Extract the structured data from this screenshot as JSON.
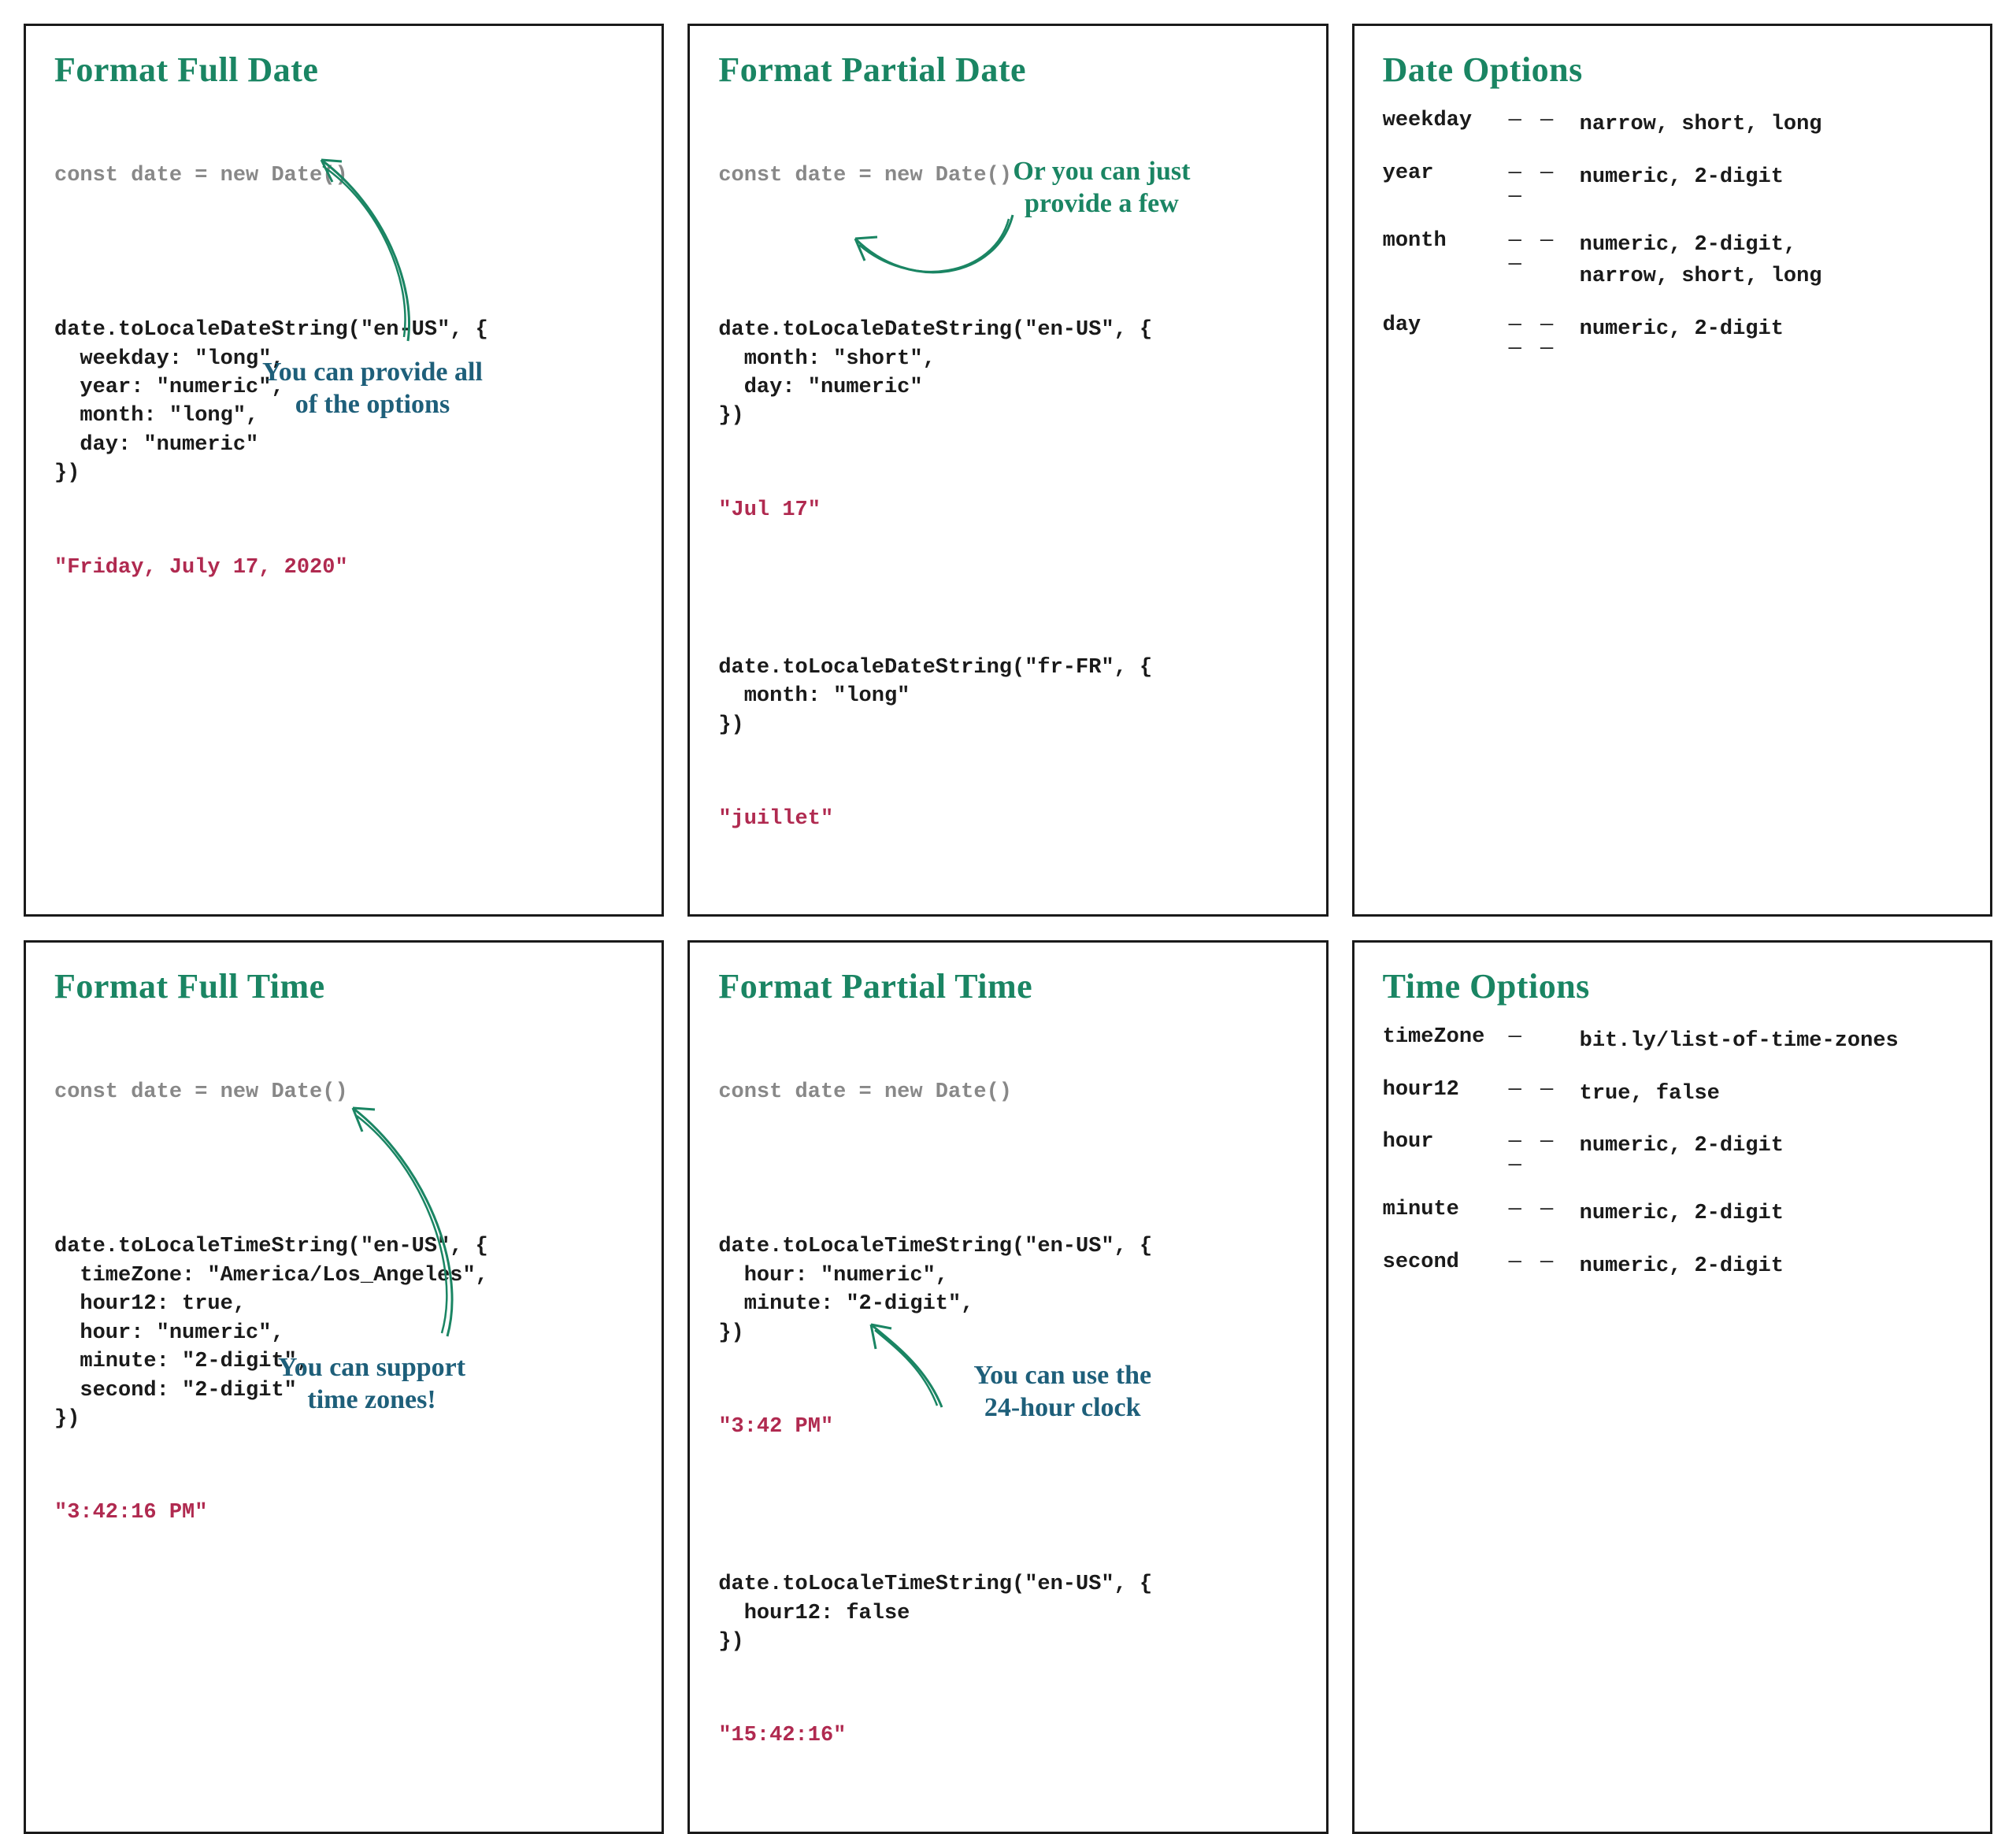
{
  "cards": {
    "full_date": {
      "title": "Format Full Date",
      "decl": "const date = new Date()",
      "code1": "date.toLocaleDateString(\"en-US\", {\n  weekday: \"long\",\n  year: \"numeric\",\n  month: \"long\",\n  day: \"numeric\"\n})",
      "output1": "\"Friday, July 17, 2020\"",
      "annot": "You can provide all\nof the options"
    },
    "partial_date": {
      "title": "Format Partial Date",
      "decl": "const date = new Date()",
      "code1": "date.toLocaleDateString(\"en-US\", {\n  month: \"short\",\n  day: \"numeric\"\n})",
      "output1": "\"Jul 17\"",
      "code2": "date.toLocaleDateString(\"fr-FR\", {\n  month: \"long\"\n})",
      "output2": "\"juillet\"",
      "annot": "Or you can just\nprovide a few"
    },
    "date_options": {
      "title": "Date Options",
      "rows": [
        {
          "key": "weekday",
          "dash": "— —",
          "val": "narrow, short, long"
        },
        {
          "key": "year",
          "dash": "— — —",
          "val": "numeric, 2-digit"
        },
        {
          "key": "month",
          "dash": "— — —",
          "val": "numeric, 2-digit,\nnarrow, short, long"
        },
        {
          "key": "day",
          "dash": "— — — —",
          "val": "numeric, 2-digit"
        }
      ]
    },
    "full_time": {
      "title": "Format Full Time",
      "decl": "const date = new Date()",
      "code1": "date.toLocaleTimeString(\"en-US\", {\n  timeZone: \"America/Los_Angeles\",\n  hour12: true,\n  hour: \"numeric\",\n  minute: \"2-digit\",\n  second: \"2-digit\"\n})",
      "output1": "\"3:42:16 PM\"",
      "annot": "You can support\ntime zones!"
    },
    "partial_time": {
      "title": "Format Partial Time",
      "decl": "const date = new Date()",
      "code1": "date.toLocaleTimeString(\"en-US\", {\n  hour: \"numeric\",\n  minute: \"2-digit\",\n})",
      "output1": "\"3:42 PM\"",
      "code2": "date.toLocaleTimeString(\"en-US\", {\n  hour12: false\n})",
      "output2": "\"15:42:16\"",
      "annot": "You can use the\n24-hour clock"
    },
    "time_options": {
      "title": "Time Options",
      "rows": [
        {
          "key": "timeZone",
          "dash": "—",
          "val": "bit.ly/list-of-time-zones"
        },
        {
          "key": "hour12",
          "dash": "— —",
          "val": "true, false"
        },
        {
          "key": "hour",
          "dash": "— — —",
          "val": "numeric, 2-digit"
        },
        {
          "key": "minute",
          "dash": "— —",
          "val": "numeric, 2-digit"
        },
        {
          "key": "second",
          "dash": "— —",
          "val": "numeric, 2-digit"
        }
      ]
    }
  }
}
